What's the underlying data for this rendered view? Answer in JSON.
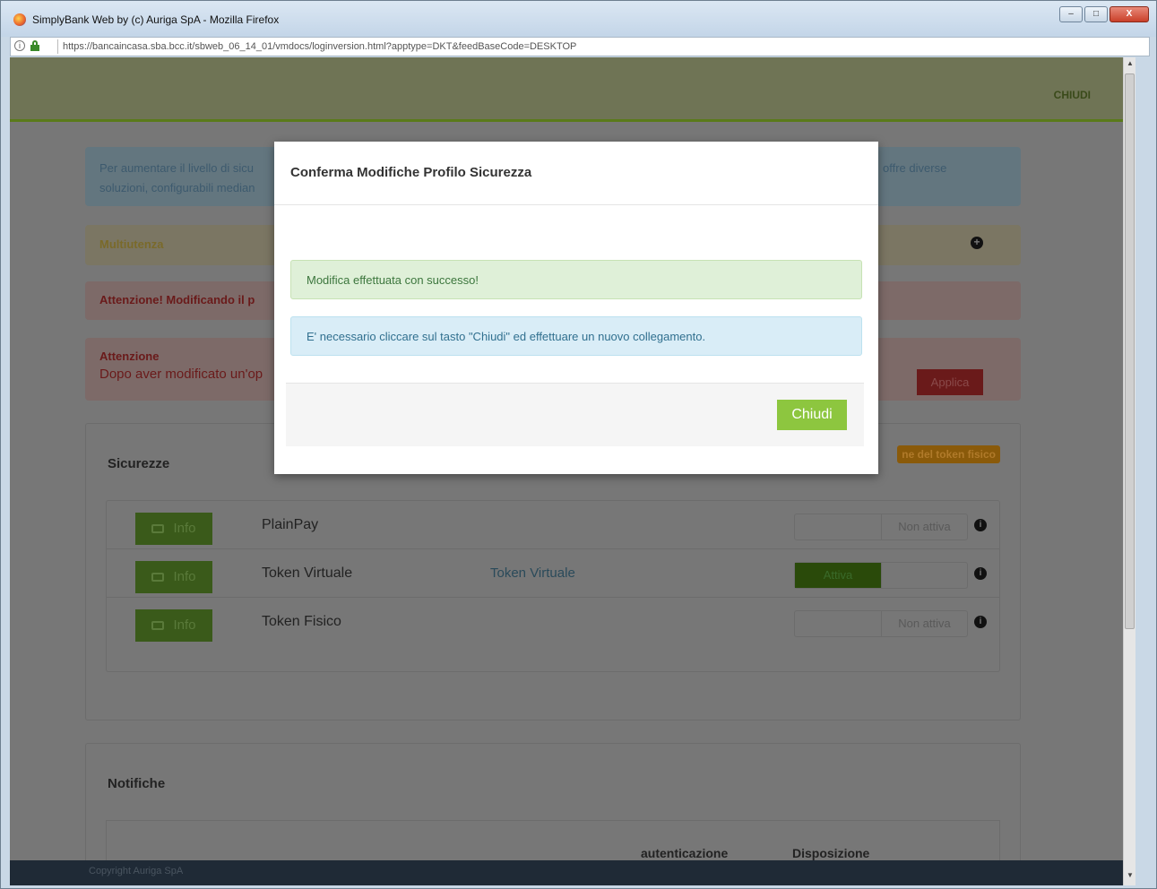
{
  "window": {
    "title": "SimplyBank Web by (c) Auriga SpA - Mozilla Firefox",
    "url": "https://bancaincasa.sba.bcc.it/sbweb_06_14_01/vmdocs/loginversion.html?apptype=DKT&feedBaseCode=DESKTOP",
    "minimize": "–",
    "maximize": "□",
    "close": "X"
  },
  "header": {
    "close_label": "CHIUDI"
  },
  "background": {
    "info_text": "Per aumentare il livello di sicu",
    "info_text2": "soluzioni, configurabili median",
    "info_text_right": "offre diverse",
    "multiutenza": "Multiutenza",
    "warning1": "Attenzione! Modificando il p",
    "warning2_title": "Attenzione",
    "warning2_text": "Dopo aver modificato un'op",
    "apply_label": "Applica",
    "sicurezze_title": "Sicurezze",
    "token_badge": "ne del token fisico",
    "rows": [
      {
        "info": "Info",
        "label": "PlainPay",
        "link": "",
        "on": "",
        "off": "Non attiva"
      },
      {
        "info": "Info",
        "label": "Token Virtuale",
        "link": "Token Virtuale",
        "on": "Attiva",
        "off": ""
      },
      {
        "info": "Info",
        "label": "Token Fisico",
        "link": "",
        "on": "",
        "off": "Non attiva"
      }
    ],
    "notifiche_title": "Notifiche",
    "col_autenticazione": "autenticazione",
    "col_disposizione": "Disposizione",
    "footer": "Copyright Auriga SpA"
  },
  "modal": {
    "title": "Conferma Modifiche Profilo Sicurezza",
    "success": "Modifica effettuata con successo!",
    "info": "E' necessario cliccare sul tasto \"Chiudi\" ed effettuare un nuovo collegamento.",
    "button": "Chiudi"
  }
}
